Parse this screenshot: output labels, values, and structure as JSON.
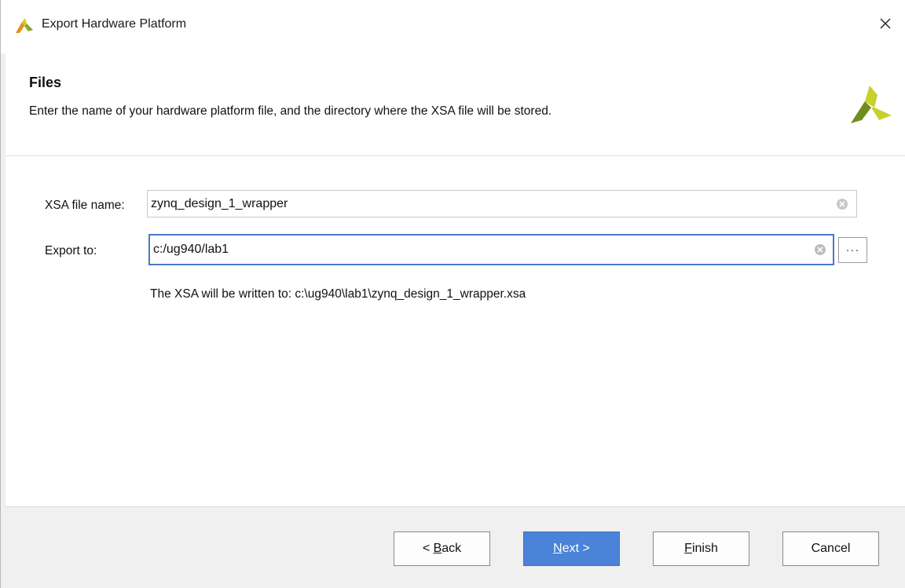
{
  "window": {
    "title": "Export Hardware Platform",
    "close_label": "×"
  },
  "header": {
    "title": "Files",
    "description": "Enter the name of your hardware platform file, and the directory where the XSA file will be stored."
  },
  "form": {
    "xsa_label": "XSA file name:",
    "xsa_value": "zynq_design_1_wrapper",
    "export_label": "Export to:",
    "export_value": "c:/ug940/lab1",
    "browse_label": "···",
    "note": "The XSA will be written to: c:\\ug940\\lab1\\zynq_design_1_wrapper.xsa"
  },
  "buttons": {
    "back": {
      "prefix": "< ",
      "mnemonic": "B",
      "rest": "ack"
    },
    "next": {
      "mnemonic": "N",
      "rest": "ext >"
    },
    "finish": {
      "mnemonic": "F",
      "rest": "inish"
    },
    "cancel": "Cancel"
  },
  "colors": {
    "accent": "#4a83d8",
    "focus_border": "#4a78c8",
    "logo_green": "#6f8d1c",
    "logo_yellow": "#c7d12a",
    "logo_orange": "#e68a1e"
  }
}
